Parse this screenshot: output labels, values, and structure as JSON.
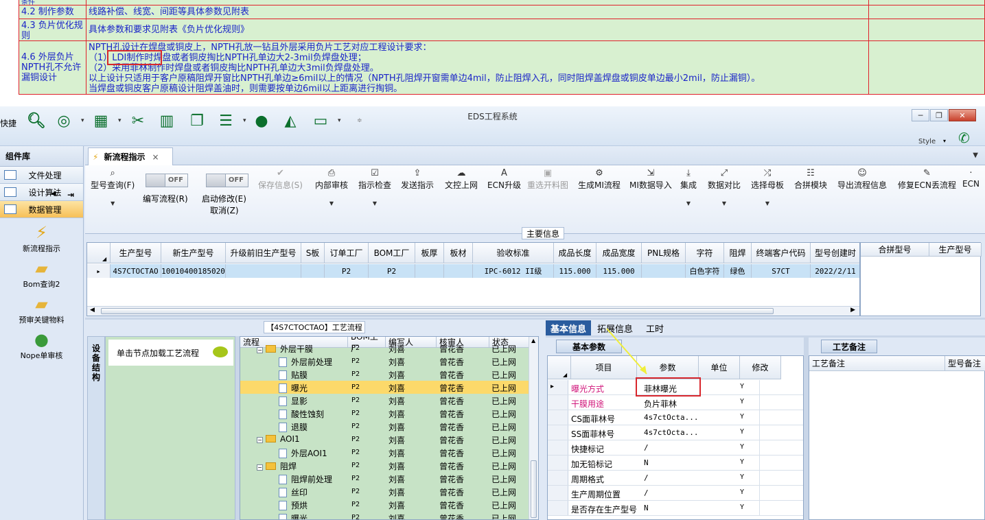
{
  "doc": {
    "top_fragment": "条件",
    "rows": [
      {
        "label": "4.2 制作参数",
        "text": "线路补偿、线宽、间距等具体参数见附表"
      },
      {
        "label": "4.3 负片优化规则",
        "text": "具体参数和要求见附表《负片优化规则》"
      },
      {
        "label": "4.6 外层负片NPTH孔不允许漏铜设计",
        "lines": [
          "NPTH孔设计在焊盘或铜皮上，NPTH孔放一钻且外层采用负片工艺对应工程设计要求：",
          "（1）LDI制作时焊盘或者铜皮掏比NPTH孔单边大2-3mil负焊盘处理；",
          "（2）采用菲林制作时焊盘或者铜皮掏比NPTH孔单边大3mil负焊盘处理。",
          "以上设计只适用于客户原稿阻焊开窗比NPTH孔单边≥6mil以上的情况（NPTH孔阻焊开窗需单边4mil，防止阻焊入孔，同时阻焊盖焊盘或铜皮单边最小2mil，防止漏铜）。",
          "当焊盘或铜皮客户原稿设计阻焊盖油时，则需要按单边6mil以上距离进行掏铜。"
        ]
      }
    ]
  },
  "app": {
    "title": "EDS工程系统",
    "quick_label": "快捷",
    "style_label": "Style",
    "nav": {
      "header": "组件库",
      "sections": [
        "文件处理",
        "设计算法",
        "数据管理"
      ],
      "tools": [
        "新流程指示",
        "Bom查询2",
        "预审关键物料",
        "Nope单审核"
      ]
    },
    "tab": {
      "label": "新流程指示",
      "close": "×"
    },
    "ribbon": {
      "buttons": [
        {
          "label": "型号查询(F)",
          "icon": "search-icon",
          "disabled": false
        },
        {
          "label": "保存信息(S)",
          "icon": "check-icon",
          "disabled": true
        },
        {
          "label": "内部审核",
          "icon": "print-icon",
          "disabled": false
        },
        {
          "label": "指示检查",
          "icon": "checkbox-icon",
          "disabled": false
        },
        {
          "label": "发送指示",
          "icon": "upload-icon",
          "disabled": false
        },
        {
          "label": "文控上网",
          "icon": "cloud-upload-icon",
          "disabled": false
        },
        {
          "label": "ECN升级",
          "icon": "text-icon",
          "disabled": false
        },
        {
          "label": "重选开料图",
          "icon": "image-icon",
          "disabled": true
        },
        {
          "label": "生成MI流程",
          "icon": "gears-icon",
          "disabled": false
        },
        {
          "label": "MI数据导入",
          "icon": "import-icon",
          "disabled": false
        },
        {
          "label": "集成",
          "icon": "download-icon",
          "disabled": false
        },
        {
          "label": "数据对比",
          "icon": "compare-icon",
          "disabled": false
        },
        {
          "label": "选择母板",
          "icon": "shuffle-icon",
          "disabled": false
        },
        {
          "label": "合拼模块",
          "icon": "list-icon",
          "disabled": false
        },
        {
          "label": "导出流程信息",
          "icon": "smile-icon",
          "disabled": false
        },
        {
          "label": "修复ECN丢流程",
          "icon": "wrench-icon",
          "disabled": false
        },
        {
          "label": "ECN",
          "icon": "more-icon",
          "disabled": false
        }
      ],
      "toggle1": {
        "state": "OFF",
        "label": "编写流程(R)"
      },
      "toggle2": {
        "state": "OFF",
        "label": "启动修改(E)",
        "sub": "取消(Z)"
      }
    },
    "main_info_title": "主要信息",
    "grid": {
      "headers": [
        "生产型号",
        "新生产型号",
        "升级前旧生产型号",
        "S板",
        "订单工厂",
        "BOM工厂",
        "板厚",
        "板材",
        "验收标准",
        "成品长度",
        "成品宽度",
        "PNL规格",
        "字符",
        "阻焊",
        "终端客户代码",
        "型号创建时"
      ],
      "row": [
        "4S7CTOCTAO",
        "10010400185020",
        "",
        "",
        "P2",
        "P2",
        "",
        "",
        "IPC-6012 II级",
        "115.000",
        "115.000",
        "",
        "白色字符",
        "绿色",
        "S7CT",
        "2022/2/11"
      ]
    },
    "grid2_headers": [
      "合拼型号",
      "生产型号"
    ],
    "process_title": "【4S7CTOCTAO】工艺流程",
    "side_tab": "设备结构",
    "node_hint": "单击节点加载工艺流程",
    "tree": {
      "headers": [
        "流程",
        "BOM工厂",
        "编写人",
        "核审人",
        "状态"
      ],
      "rows": [
        {
          "name": "外层干膜",
          "type": "folder",
          "level": 1,
          "bom": "P2",
          "writer": "刘喜",
          "reviewer": "曾花香",
          "status": "已上网"
        },
        {
          "name": "外层前处理",
          "type": "doc",
          "level": 2,
          "bom": "P2",
          "writer": "刘喜",
          "reviewer": "曾花香",
          "status": "已上网"
        },
        {
          "name": "贴膜",
          "type": "doc",
          "level": 2,
          "bom": "P2",
          "writer": "刘喜",
          "reviewer": "曾花香",
          "status": "已上网"
        },
        {
          "name": "曝光",
          "type": "doc",
          "level": 2,
          "bom": "P2",
          "writer": "刘喜",
          "reviewer": "曾花香",
          "status": "已上网",
          "selected": true
        },
        {
          "name": "显影",
          "type": "doc",
          "level": 2,
          "bom": "P2",
          "writer": "刘喜",
          "reviewer": "曾花香",
          "status": "已上网"
        },
        {
          "name": "酸性蚀刻",
          "type": "doc",
          "level": 2,
          "bom": "P2",
          "writer": "刘喜",
          "reviewer": "曾花香",
          "status": "已上网"
        },
        {
          "name": "退膜",
          "type": "doc",
          "level": 2,
          "bom": "P2",
          "writer": "刘喜",
          "reviewer": "曾花香",
          "status": "已上网"
        },
        {
          "name": "AOI1",
          "type": "folder",
          "level": 1,
          "bom": "P2",
          "writer": "刘喜",
          "reviewer": "曾花香",
          "status": "已上网"
        },
        {
          "name": "外层AOI1",
          "type": "doc",
          "level": 2,
          "bom": "P2",
          "writer": "刘喜",
          "reviewer": "曾花香",
          "status": "已上网"
        },
        {
          "name": "阻焊",
          "type": "folder",
          "level": 1,
          "bom": "P2",
          "writer": "刘喜",
          "reviewer": "曾花香",
          "status": "已上网"
        },
        {
          "name": "阻焊前处理",
          "type": "doc",
          "level": 2,
          "bom": "P2",
          "writer": "刘喜",
          "reviewer": "曾花香",
          "status": "已上网"
        },
        {
          "name": "丝印",
          "type": "doc",
          "level": 2,
          "bom": "P2",
          "writer": "刘喜",
          "reviewer": "曾花香",
          "status": "已上网"
        },
        {
          "name": "预烘",
          "type": "doc",
          "level": 2,
          "bom": "P2",
          "writer": "刘喜",
          "reviewer": "曾花香",
          "status": "已上网"
        },
        {
          "name": "曝光",
          "type": "doc",
          "level": 2,
          "bom": "P2",
          "writer": "刘喜",
          "reviewer": "曾花香",
          "status": "已上网"
        }
      ]
    },
    "right_tabs": [
      "基本信息",
      "拓展信息",
      "工时"
    ],
    "basic_params_title": "基本参数",
    "params": {
      "headers": [
        "项目",
        "参数",
        "单位",
        "修改"
      ],
      "rows": [
        {
          "item": "曝光方式",
          "value": "菲林曝光",
          "unit": "",
          "mod": "Y",
          "pink": true,
          "current": true
        },
        {
          "item": "干膜用途",
          "value": "负片菲林",
          "unit": "",
          "mod": "Y",
          "pink": true
        },
        {
          "item": "CS面菲林号",
          "value": "4s7ctOcta...",
          "unit": "",
          "mod": "Y"
        },
        {
          "item": "SS面菲林号",
          "value": "4s7ctOcta...",
          "unit": "",
          "mod": "Y"
        },
        {
          "item": "快捷标记",
          "value": "/",
          "unit": "",
          "mod": "Y"
        },
        {
          "item": "加无铅标记",
          "value": "N",
          "unit": "",
          "mod": "Y"
        },
        {
          "item": "周期格式",
          "value": "/",
          "unit": "",
          "mod": "Y"
        },
        {
          "item": "生产周期位置",
          "value": "/",
          "unit": "",
          "mod": "Y"
        },
        {
          "item": "是否存在生产型号",
          "value": "N",
          "unit": "",
          "mod": "Y"
        }
      ]
    },
    "process_note_title": "工艺备注",
    "process_note_headers": [
      "工艺备注",
      "型号备注"
    ]
  },
  "colors": {
    "doc_text": "#1a24c8",
    "doc_border": "#e0202a",
    "doc_bg": "#d8f0d0",
    "highlight_box": "#d8262c",
    "selected_row": "#fcd96a",
    "tree_bg": "#c7e3c6",
    "active_tab": "#2a5c9e"
  }
}
